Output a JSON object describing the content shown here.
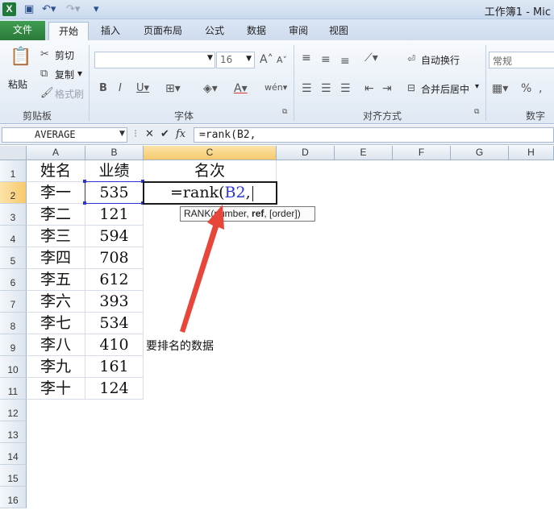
{
  "window": {
    "title": "工作簿1 - Mic"
  },
  "tabs": [
    {
      "label": "文件"
    },
    {
      "label": "开始"
    },
    {
      "label": "插入"
    },
    {
      "label": "页面布局"
    },
    {
      "label": "公式"
    },
    {
      "label": "数据"
    },
    {
      "label": "审阅"
    },
    {
      "label": "视图"
    }
  ],
  "ribbon": {
    "clipboard": {
      "paste": "粘贴",
      "cut": "剪切",
      "copy": "复制",
      "format_painter": "格式刷",
      "label": "剪贴板"
    },
    "font": {
      "size": "16",
      "label": "字体"
    },
    "alignment": {
      "wrap_text": "自动换行",
      "merge_center": "合并后居中",
      "label": "对齐方式"
    },
    "number": {
      "format": "常规",
      "label": "数字"
    }
  },
  "formula_bar": {
    "name_box": "AVERAGE",
    "fx": "fx",
    "formula": "=rank(B2,"
  },
  "columns": [
    "A",
    "B",
    "C",
    "D",
    "E",
    "F",
    "G",
    "H"
  ],
  "rows": [
    "1",
    "2",
    "3",
    "4",
    "5",
    "6",
    "7",
    "8",
    "9",
    "10",
    "11",
    "12",
    "13",
    "14",
    "15",
    "16"
  ],
  "headers": {
    "name": "姓名",
    "score": "业绩",
    "rank": "名次"
  },
  "records": [
    {
      "name": "李一",
      "score": "535"
    },
    {
      "name": "李二",
      "score": "121"
    },
    {
      "name": "李三",
      "score": "594"
    },
    {
      "name": "李四",
      "score": "708"
    },
    {
      "name": "李五",
      "score": "612"
    },
    {
      "name": "李六",
      "score": "393"
    },
    {
      "name": "李七",
      "score": "534"
    },
    {
      "name": "李八",
      "score": "410"
    },
    {
      "name": "李九",
      "score": "161"
    },
    {
      "name": "李十",
      "score": "124"
    }
  ],
  "editing_cell": {
    "prefix": "=rank(",
    "ref": "B2",
    "suffix": ","
  },
  "tooltip": {
    "fn": "RANK(number, ",
    "bold": "ref",
    "rest": ", [order])"
  },
  "annotation": "要排名的数据",
  "colors": {
    "ref_blue": "#2b35d4",
    "arrow_red": "#e8463a",
    "excel_green": "#1f7a3a"
  }
}
